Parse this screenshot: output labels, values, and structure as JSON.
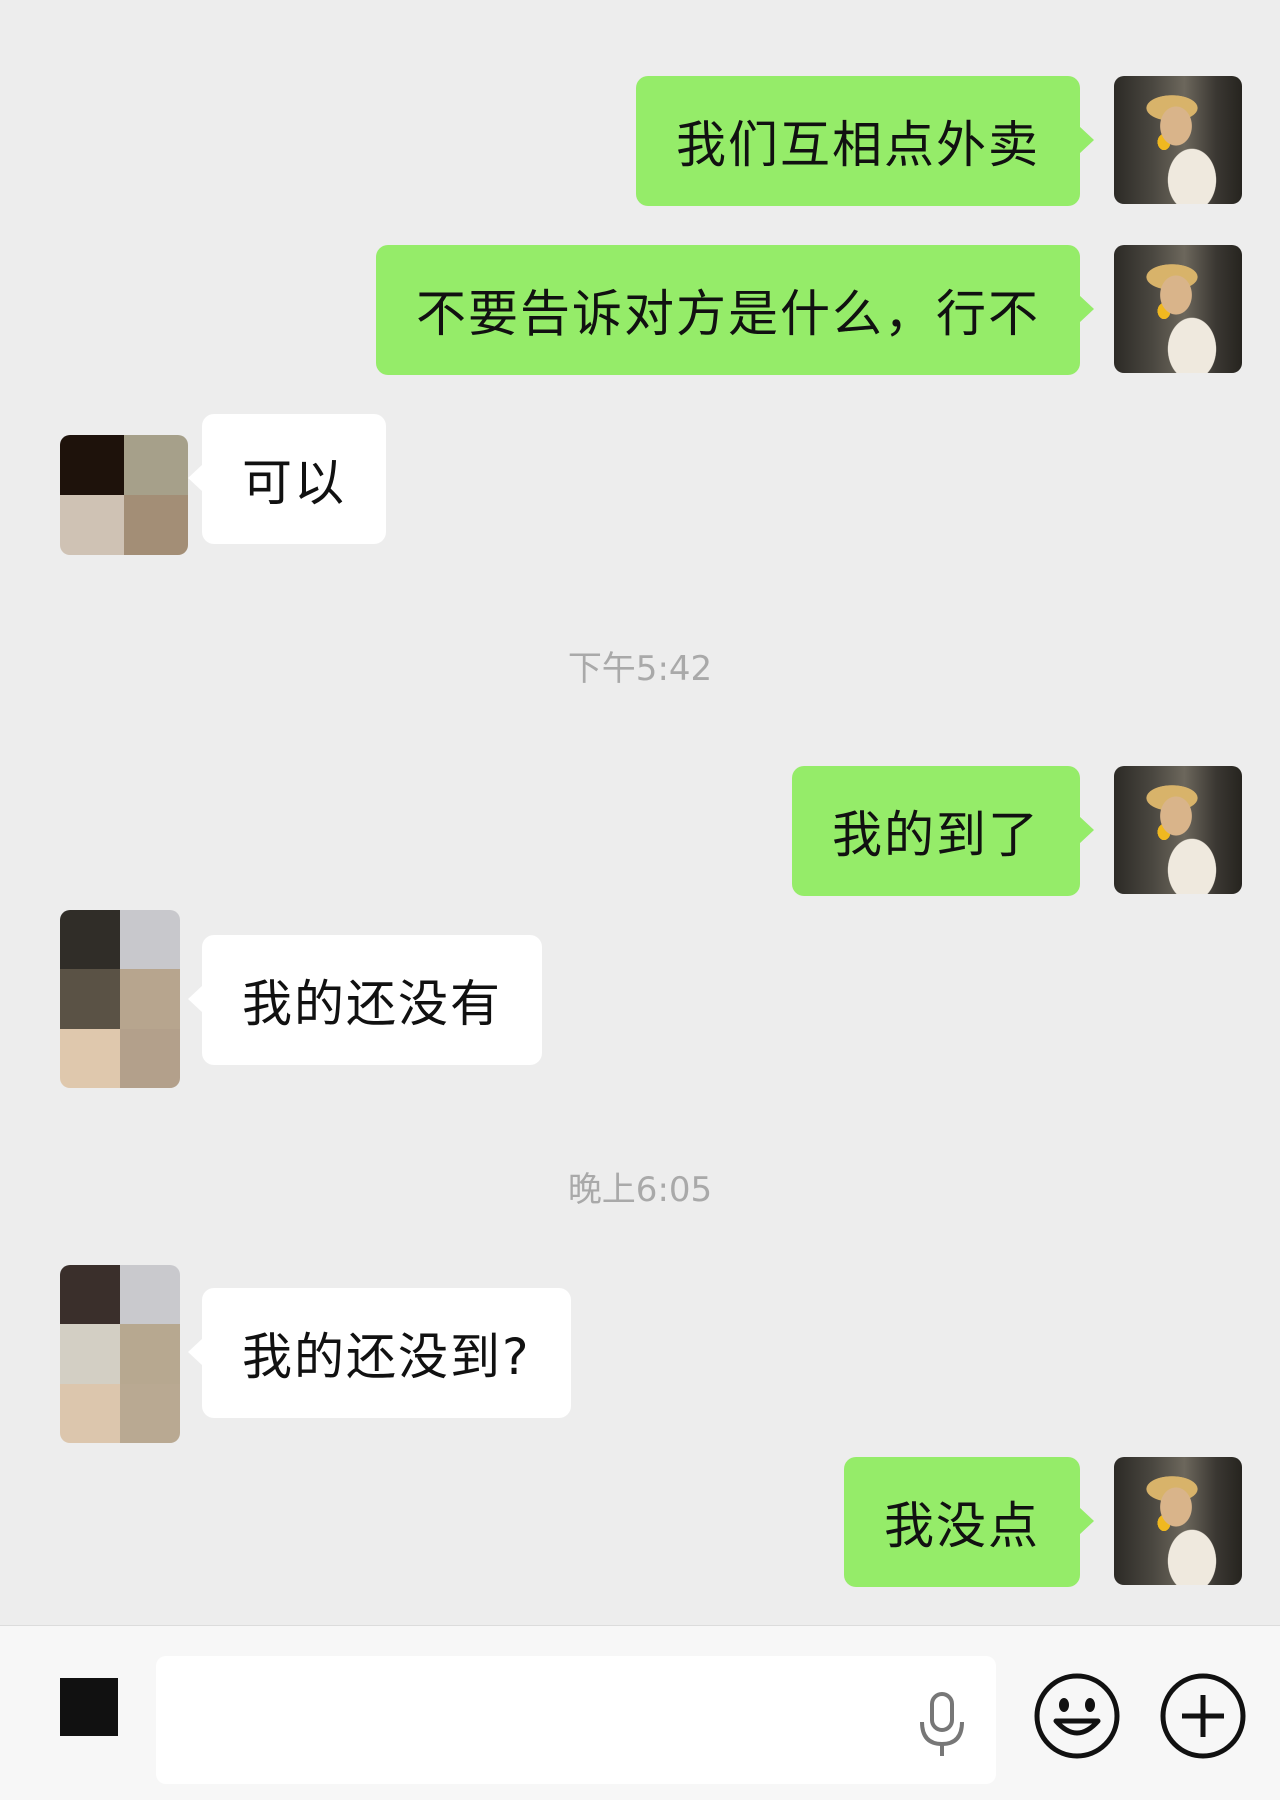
{
  "messages": [
    {
      "side": "self",
      "text": "我们互相点外卖"
    },
    {
      "side": "self",
      "text": "不要告诉对方是什么，行不"
    },
    {
      "side": "other",
      "text": "可以"
    },
    {
      "type": "time",
      "text": "下午5:42"
    },
    {
      "side": "self",
      "text": "我的到了"
    },
    {
      "side": "other",
      "text": "我的还没有"
    },
    {
      "type": "time",
      "text": "晚上6:05"
    },
    {
      "side": "other",
      "text": "我的还没到?"
    },
    {
      "side": "self",
      "text": "我没点"
    }
  ],
  "input": {
    "value": "",
    "placeholder": ""
  },
  "icons": {
    "keyboard": "keyboard-toggle-icon",
    "mic": "microphone-icon",
    "emoji": "emoji-icon",
    "more": "plus-icon"
  },
  "colors": {
    "self_bubble": "#95ec69",
    "other_bubble": "#ffffff",
    "background": "#ededed"
  }
}
